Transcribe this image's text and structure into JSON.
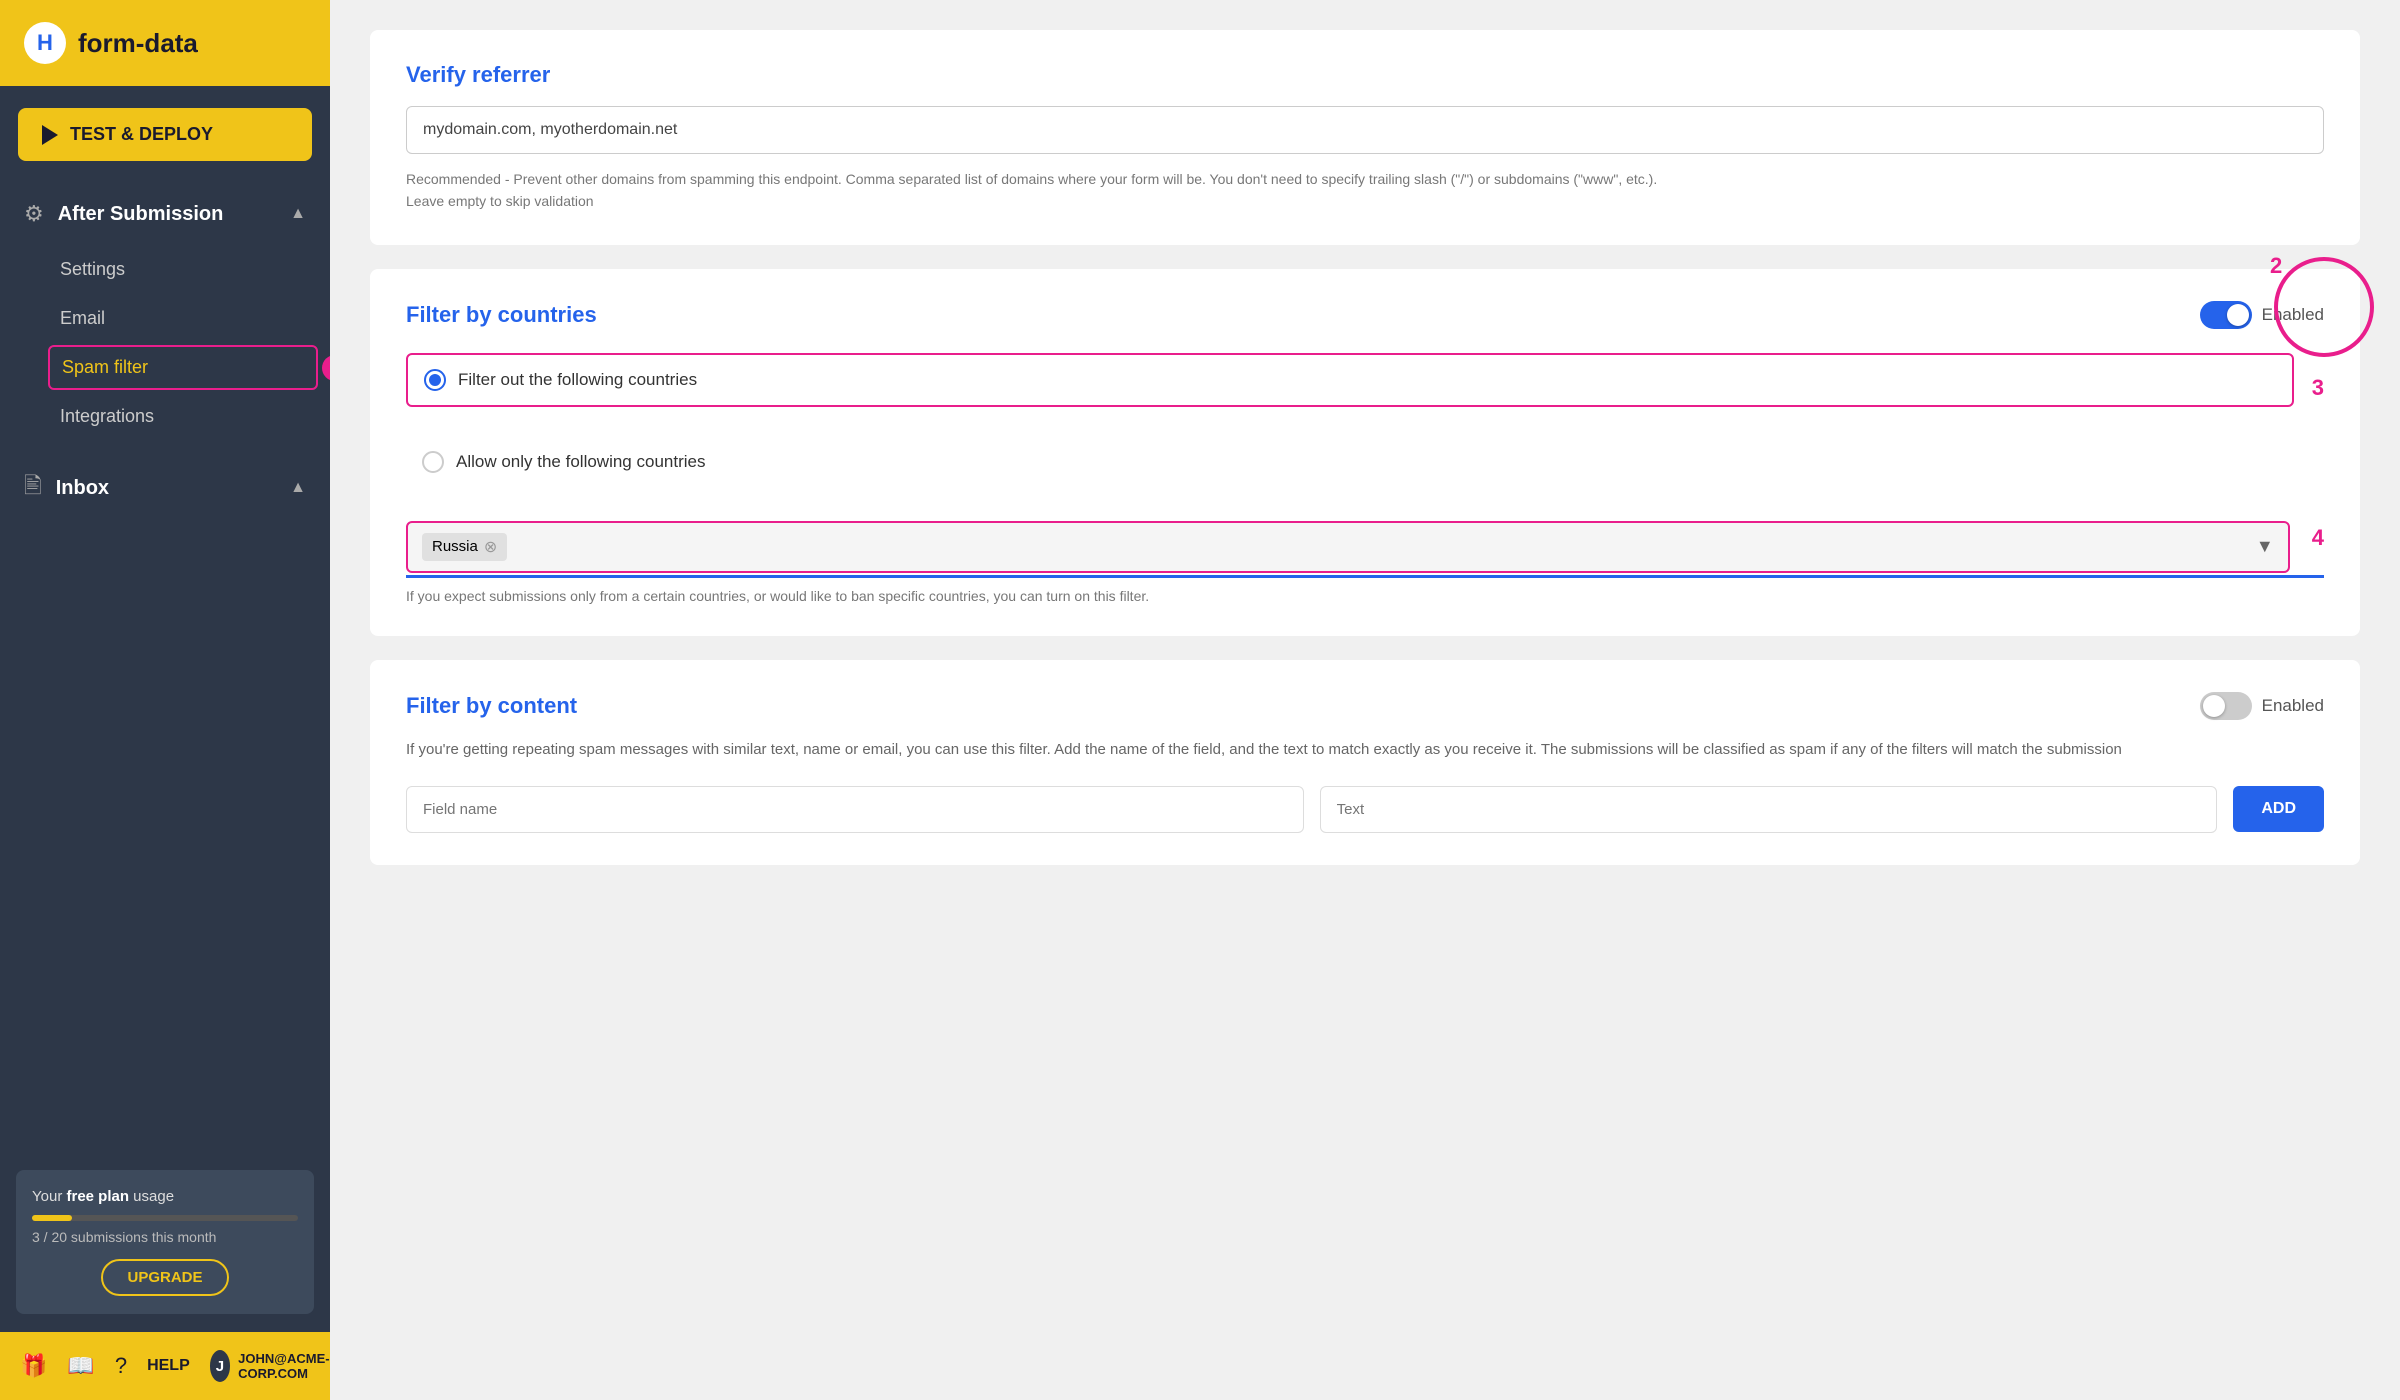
{
  "app": {
    "logo_letter": "H",
    "logo_text": "form-data"
  },
  "sidebar": {
    "deploy_button": "TEST & DEPLOY",
    "after_submission": {
      "label": "After Submission",
      "items": [
        "Settings",
        "Email",
        "Spam filter",
        "Integrations"
      ]
    },
    "inbox": {
      "label": "Inbox"
    },
    "plan": {
      "text_prefix": "Your ",
      "plan_type": "free plan",
      "text_suffix": " usage",
      "count": "3 / 20 submissions this month",
      "upgrade_btn": "UPGRADE"
    },
    "footer": {
      "help_text": "HELP",
      "user_email": "JOHN@ACME-CORP.COM"
    }
  },
  "main": {
    "verify_referrer": {
      "title": "Verify referrer",
      "input_value": "mydomain.com, myotherdomain.net",
      "hint": "Recommended - Prevent other domains from spamming this endpoint. Comma separated list of domains where your form will be. You don't need to specify trailing slash (\"/\") or subdomains (\"www\", etc.).\nLeave empty to skip validation"
    },
    "filter_countries": {
      "title": "Filter by countries",
      "toggle_label": "Enabled",
      "toggle_on": true,
      "annotation_toggle": "2",
      "option1": "Filter out the following countries",
      "option1_selected": true,
      "option2": "Allow only the following countries",
      "annotation_option": "3",
      "selected_country": "Russia",
      "annotation_dropdown": "4",
      "hint": "If you expect submissions only from a certain countries, or would like to ban specific countries, you can turn on this filter."
    },
    "filter_content": {
      "title": "Filter by content",
      "toggle_label": "Enabled",
      "toggle_on": false,
      "desc": "If you're getting repeating spam messages with similar text, name or email, you can use this filter. Add the name of the field, and the text to match exactly as you receive it. The submissions will be classified as spam if any of the filters will match the submission",
      "field_name_placeholder": "Field name",
      "text_placeholder": "Text",
      "add_btn": "ADD"
    }
  }
}
